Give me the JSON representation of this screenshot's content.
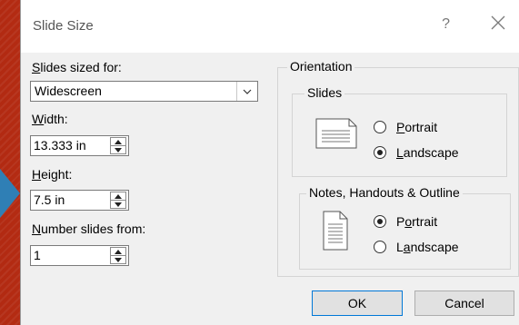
{
  "window": {
    "title": "Slide Size",
    "help_label": "?"
  },
  "slides_sized_for": {
    "label_u": "S",
    "label_rest": "lides sized for:",
    "value": "Widescreen"
  },
  "width": {
    "label_u": "W",
    "label_rest": "idth:",
    "value": "13.333 in"
  },
  "height": {
    "label_u": "H",
    "label_rest": "eight:",
    "value": "7.5 in"
  },
  "number_from": {
    "label_u": "N",
    "label_rest": "umber slides from:",
    "value": "1"
  },
  "orientation": {
    "title": "Orientation",
    "slides": {
      "title": "Slides",
      "portrait": {
        "u": "P",
        "rest": "ortrait",
        "selected": false
      },
      "landscape": {
        "u": "L",
        "rest": "andscape",
        "selected": true
      }
    },
    "notes": {
      "title": "Notes, Handouts & Outline",
      "portrait": {
        "pre": "P",
        "u": "o",
        "rest": "rtrait",
        "selected": true
      },
      "landscape": {
        "pre": "L",
        "u": "a",
        "rest": "ndscape",
        "selected": false
      }
    }
  },
  "buttons": {
    "ok": "OK",
    "cancel": "Cancel"
  }
}
